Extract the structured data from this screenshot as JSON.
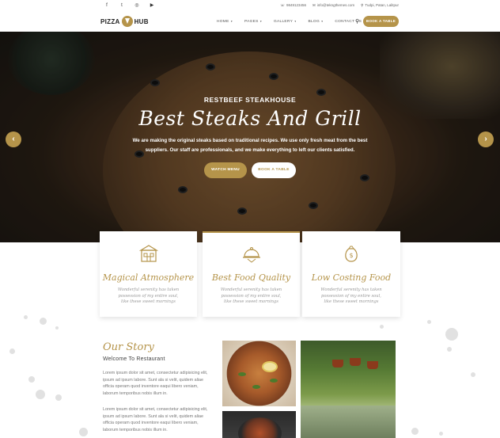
{
  "topbar": {
    "social": [
      {
        "icon": "facebook-icon",
        "glyph": "f"
      },
      {
        "icon": "twitter-icon",
        "glyph": "t"
      },
      {
        "icon": "instagram-icon",
        "glyph": "◎"
      },
      {
        "icon": "youtube-icon",
        "glyph": "▶"
      }
    ],
    "phone": "9849123456",
    "email": "info@tekngthemes.com",
    "location": "Tudpi, Patan, Lalitpur"
  },
  "header": {
    "logo_left": "PIZZA",
    "logo_right": "HUB",
    "nav": [
      "HOME",
      "PAGES",
      "GALLERY",
      "BLOG",
      "CONTACT US"
    ],
    "book_button": "BOOK A TABLE"
  },
  "hero": {
    "subtitle": "RESTBEEF STEAKHOUSE",
    "title": "Best Steaks And Grill",
    "text": "We are making the original steaks based on traditional recipes. We use only fresh meat from the best suppliers. Our staff are professionals, and we make everything to left our clients satisfied.",
    "watch_button": "WATCH MENU",
    "book_button": "BOOK A TABLE",
    "prev_glyph": "‹",
    "next_glyph": "›"
  },
  "features": [
    {
      "icon": "restaurant-building-icon",
      "title": "Magical Atmosphere",
      "desc": "Wonderful serenity has taken possession of my entire soul, like these sweet mornings"
    },
    {
      "icon": "food-cloche-icon",
      "title": "Best Food Quality",
      "desc": "Wonderful serenity has taken possession of my entire soul, like these sweet mornings"
    },
    {
      "icon": "money-bag-icon",
      "title": "Low Costing Food",
      "desc": "Wonderful serenity has taken possession of my entire soul, like these sweet mornings"
    }
  ],
  "story": {
    "title": "Our Story",
    "subtitle": "Welcome To Restaurant",
    "p1": "Lorem ipsum dolor sit amet, consectetur adipisicing elit, ipsum ad ipsum labore. Sunt ala si velit, quidem aliae officia operam quod inventore eaqui libero veniam, laborum temporibus nobis illum in.",
    "p2": "Lorem ipsum dolor sit amet, consectetur adipisicing elit, ipsum ad ipsum labore. Sunt ala si velit, quidem aliae officia operam quod inventore eaqui libero veniam, laborum temporibus nobis illum in."
  },
  "colors": {
    "accent": "#b5944a",
    "dark": "#222222",
    "muted": "#999999"
  }
}
